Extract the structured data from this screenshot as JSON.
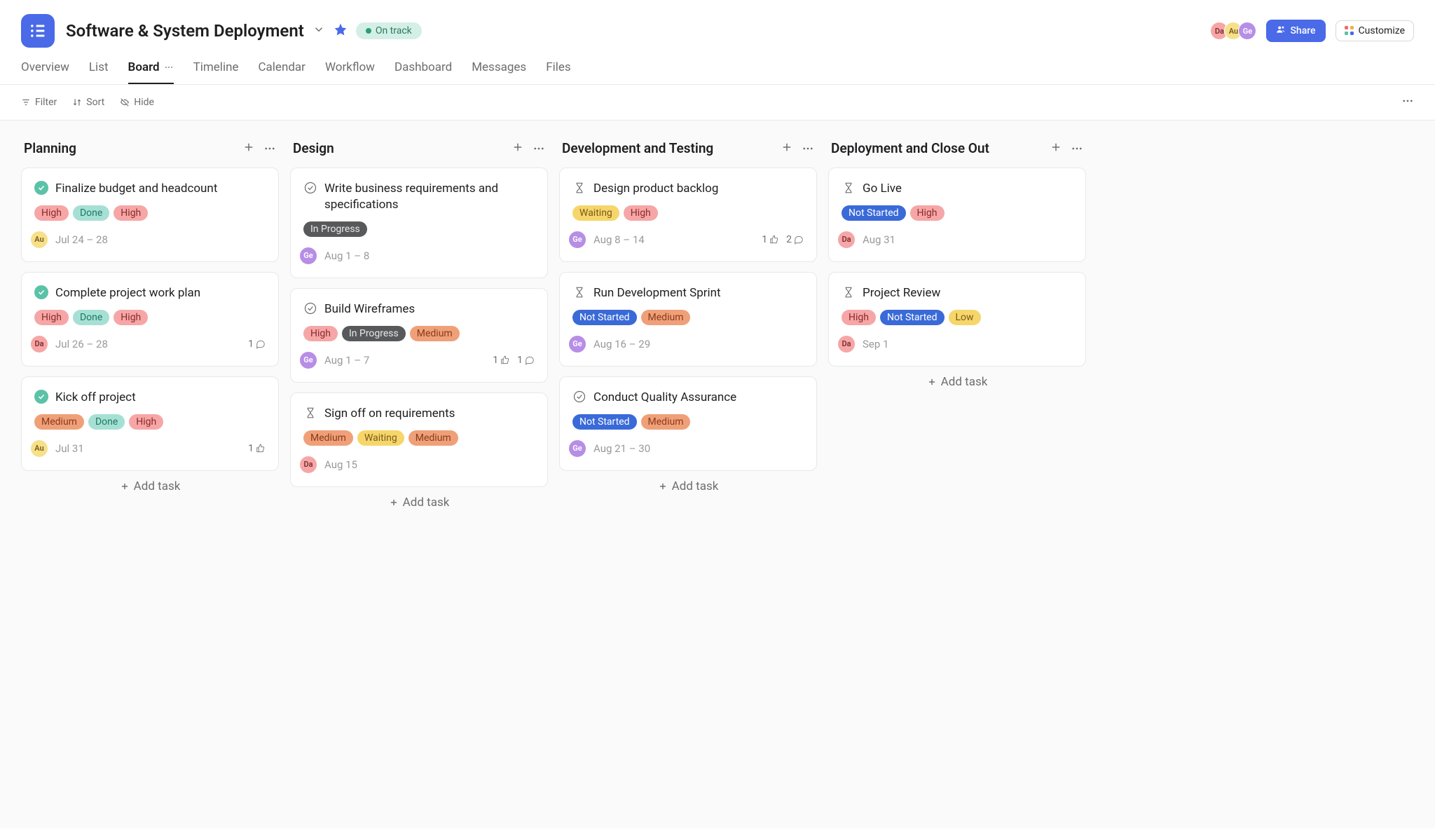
{
  "header": {
    "title": "Software & System Deployment",
    "status": "On track",
    "members": [
      {
        "initials": "Da",
        "cls": "av-da"
      },
      {
        "initials": "Au",
        "cls": "av-au"
      },
      {
        "initials": "Ge",
        "cls": "av-ge"
      }
    ],
    "share": "Share",
    "customize": "Customize"
  },
  "tabs": [
    "Overview",
    "List",
    "Board",
    "Timeline",
    "Calendar",
    "Workflow",
    "Dashboard",
    "Messages",
    "Files"
  ],
  "active_tab": "Board",
  "toolbar": {
    "filter": "Filter",
    "sort": "Sort",
    "hide": "Hide"
  },
  "add_task_label": "Add task",
  "columns": [
    {
      "name": "Planning",
      "cards": [
        {
          "title": "Finalize budget and headcount",
          "icon": "done",
          "tags": [
            [
              "High",
              "red"
            ],
            [
              "Done",
              "teal"
            ],
            [
              "High",
              "red"
            ]
          ],
          "assignee": {
            "initials": "Au",
            "cls": "av-au"
          },
          "date": "Jul 24 – 28"
        },
        {
          "title": "Complete project work plan",
          "icon": "done",
          "tags": [
            [
              "High",
              "red"
            ],
            [
              "Done",
              "teal"
            ],
            [
              "High",
              "red"
            ]
          ],
          "assignee": {
            "initials": "Da",
            "cls": "av-da"
          },
          "date": "Jul 26 – 28",
          "comments": 1
        },
        {
          "title": "Kick off project",
          "icon": "done-diamond",
          "tags": [
            [
              "Medium",
              "orange"
            ],
            [
              "Done",
              "teal"
            ],
            [
              "High",
              "red"
            ]
          ],
          "assignee": {
            "initials": "Au",
            "cls": "av-au"
          },
          "date": "Jul 31",
          "likes": 1
        }
      ]
    },
    {
      "name": "Design",
      "cards": [
        {
          "title": "Write business requirements and specifications",
          "icon": "open",
          "tags": [
            [
              "In Progress",
              "gray"
            ]
          ],
          "assignee": {
            "initials": "Ge",
            "cls": "av-ge"
          },
          "date": "Aug 1 – 8"
        },
        {
          "title": "Build Wireframes",
          "icon": "open",
          "tags": [
            [
              "High",
              "red"
            ],
            [
              "In Progress",
              "gray"
            ],
            [
              "Medium",
              "orange"
            ]
          ],
          "assignee": {
            "initials": "Ge",
            "cls": "av-ge"
          },
          "date": "Aug 1 – 7",
          "likes": 1,
          "comments": 1
        },
        {
          "title": "Sign off on requirements",
          "icon": "hourglass",
          "tags": [
            [
              "Medium",
              "orange"
            ],
            [
              "Waiting",
              "yellow"
            ],
            [
              "Medium",
              "orange"
            ]
          ],
          "assignee": {
            "initials": "Da",
            "cls": "av-da"
          },
          "date": "Aug 15"
        }
      ]
    },
    {
      "name": "Development and Testing",
      "cards": [
        {
          "title": "Design product backlog",
          "icon": "hourglass",
          "tags": [
            [
              "Waiting",
              "yellow"
            ],
            [
              "High",
              "red"
            ]
          ],
          "assignee": {
            "initials": "Ge",
            "cls": "av-ge"
          },
          "date": "Aug 8 – 14",
          "likes": 1,
          "comments": 2
        },
        {
          "title": "Run Development Sprint",
          "icon": "hourglass",
          "tags": [
            [
              "Not Started",
              "blue"
            ],
            [
              "Medium",
              "orange"
            ]
          ],
          "assignee": {
            "initials": "Ge",
            "cls": "av-ge"
          },
          "date": "Aug 16 – 29"
        },
        {
          "title": "Conduct Quality Assurance",
          "icon": "open",
          "tags": [
            [
              "Not Started",
              "blue"
            ],
            [
              "Medium",
              "orange"
            ]
          ],
          "assignee": {
            "initials": "Ge",
            "cls": "av-ge"
          },
          "date": "Aug 21 – 30"
        }
      ]
    },
    {
      "name": "Deployment and Close Out",
      "cards": [
        {
          "title": "Go Live",
          "icon": "hourglass",
          "tags": [
            [
              "Not Started",
              "blue"
            ],
            [
              "High",
              "red"
            ]
          ],
          "assignee": {
            "initials": "Da",
            "cls": "av-da"
          },
          "date": "Aug 31"
        },
        {
          "title": "Project Review",
          "icon": "hourglass",
          "tags": [
            [
              "High",
              "red"
            ],
            [
              "Not Started",
              "blue"
            ],
            [
              "Low",
              "yellow"
            ]
          ],
          "assignee": {
            "initials": "Da",
            "cls": "av-da"
          },
          "date": "Sep 1"
        }
      ]
    }
  ]
}
